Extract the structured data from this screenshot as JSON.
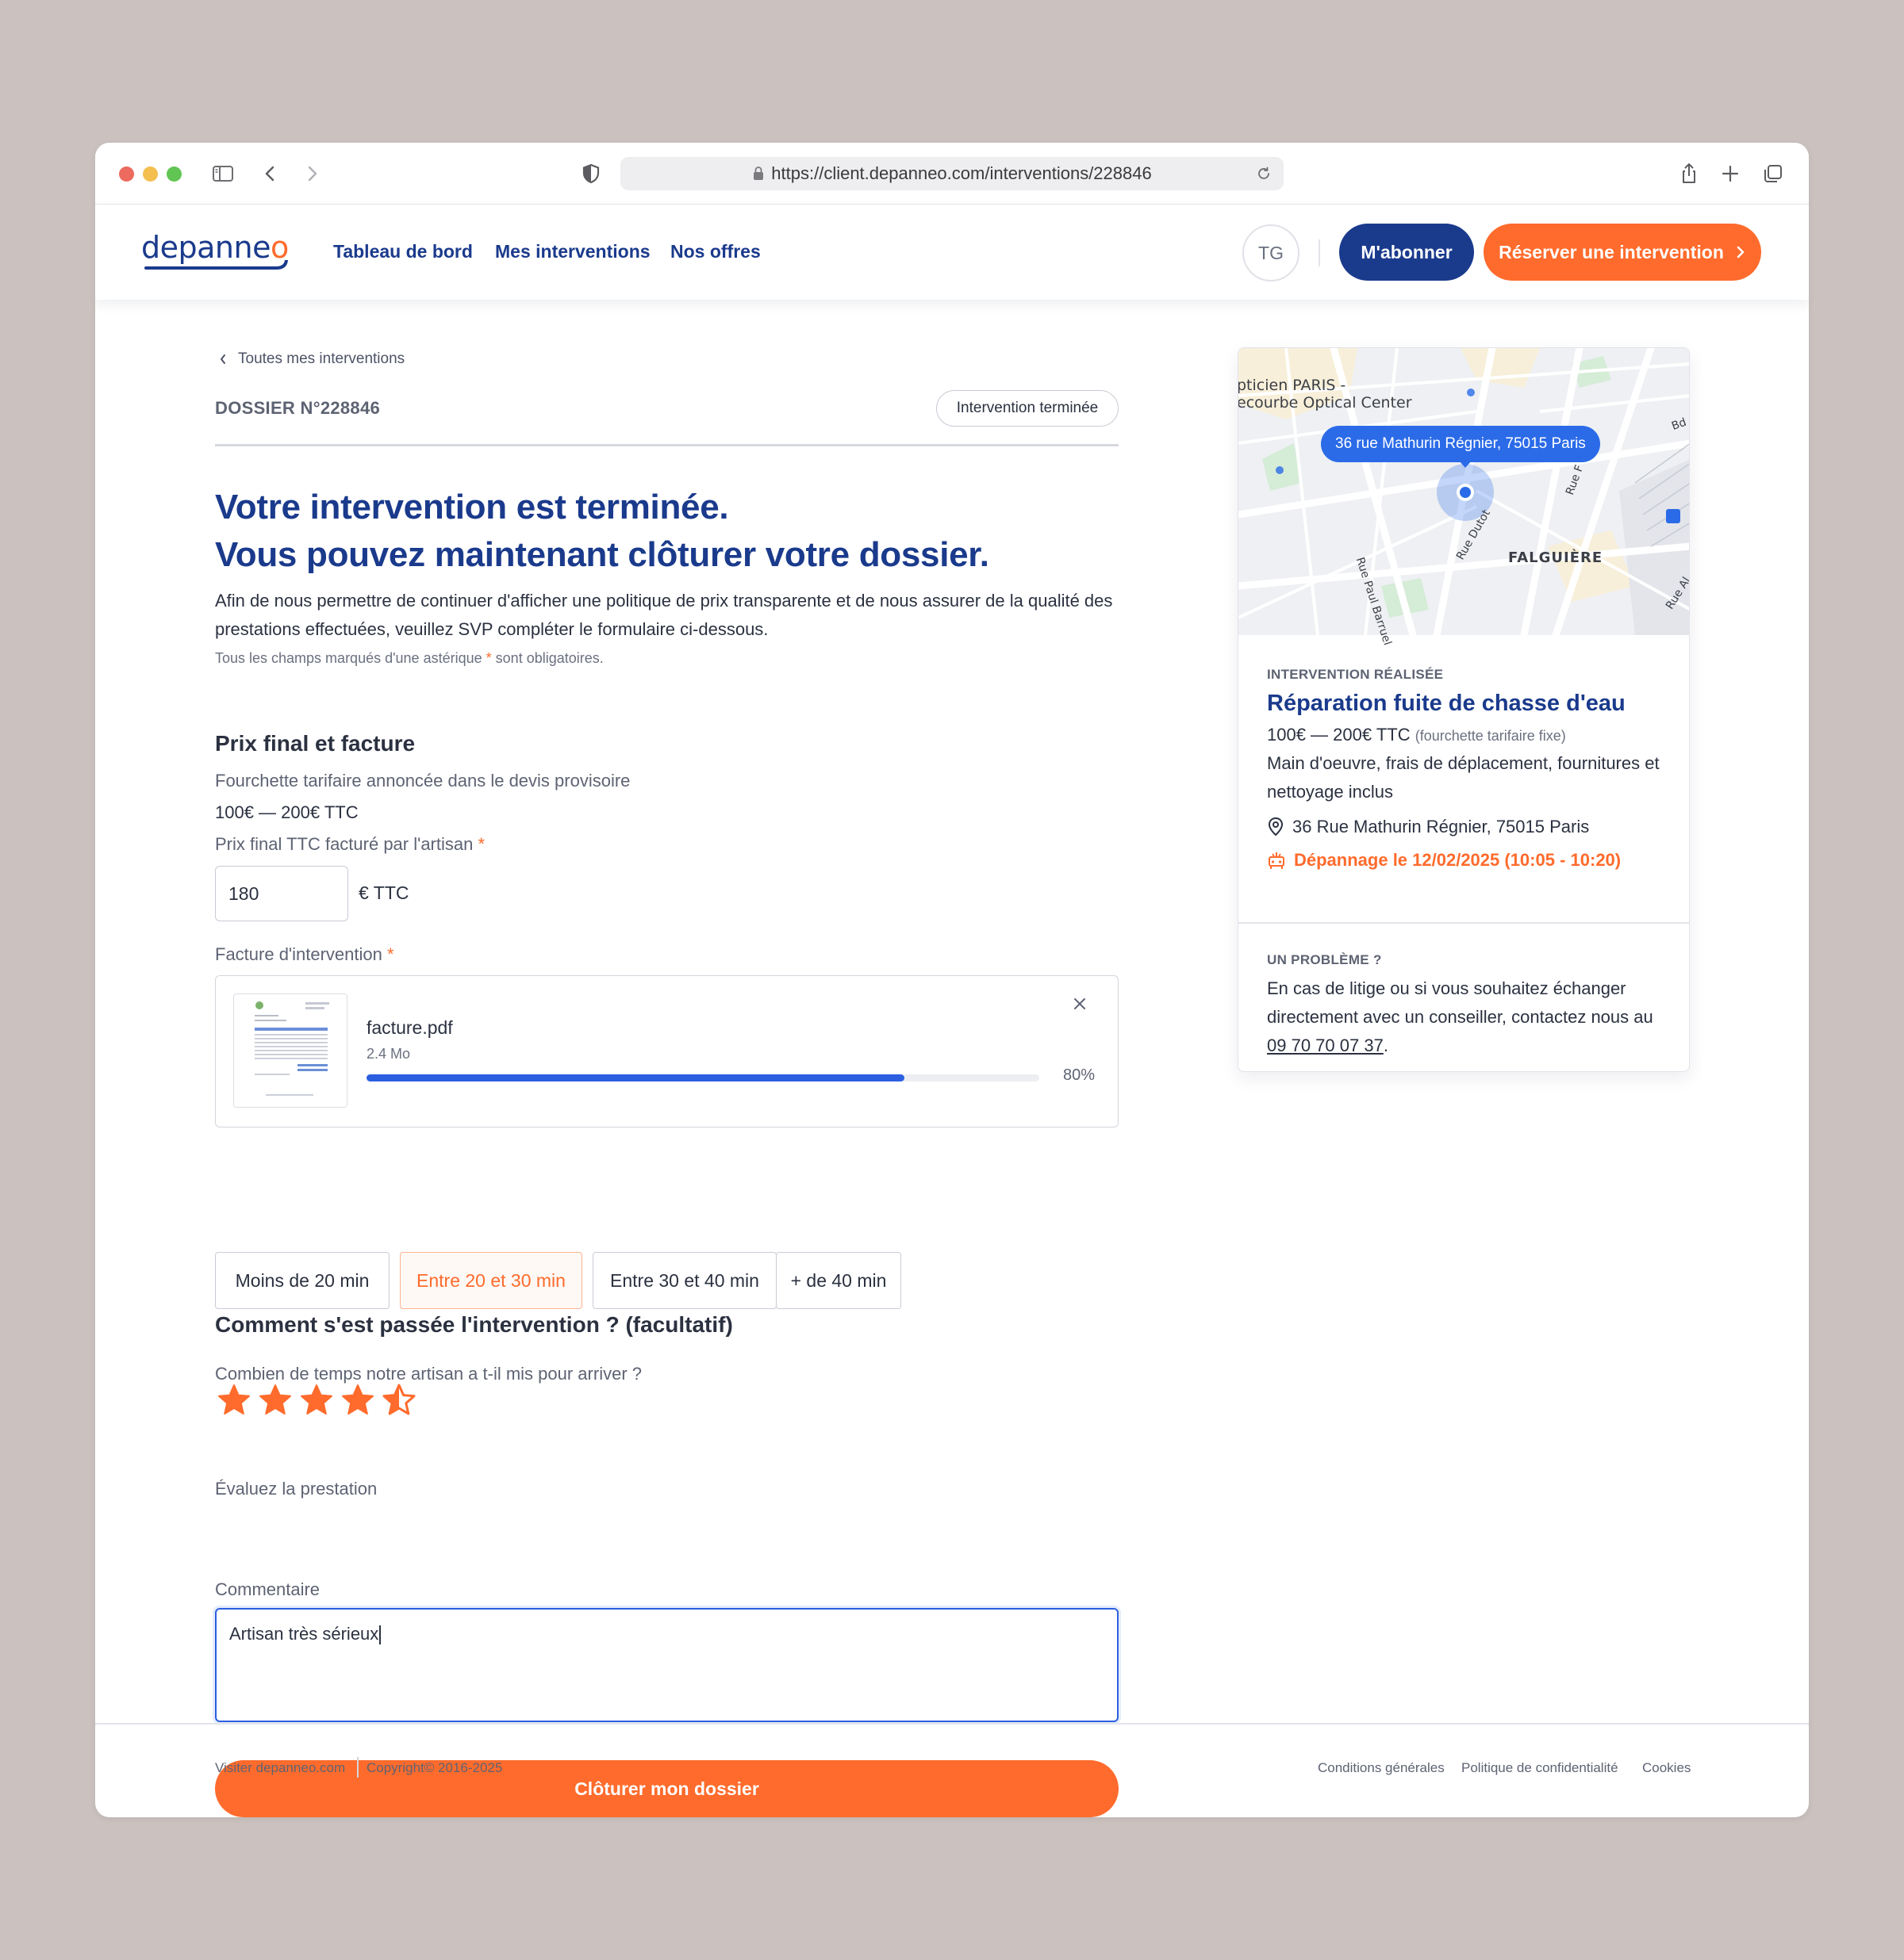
{
  "browser": {
    "url": "https://client.depanneo.com/interventions/228846"
  },
  "header": {
    "logo": "depanneo",
    "nav": [
      "Tableau de bord",
      "Mes interventions",
      "Nos offres"
    ],
    "avatar_initials": "TG",
    "subscribe_label": "M'abonner",
    "book_label": "Réserver une intervention"
  },
  "main": {
    "back_link": "Toutes mes interventions",
    "dossier": "DOSSIER N°228846",
    "status": "Intervention terminée",
    "title_line1": "Votre intervention est terminée.",
    "title_line2": "Vous pouvez maintenant clôturer votre dossier.",
    "intro": "Afin de nous permettre de continuer d'afficher une politique de prix transparente et de nous assurer de la qualité des prestations effectuées, veuillez SVP compléter le formulaire ci-dessous.",
    "required_note_before": "Tous les champs marqués d'une astérique",
    "required_note_after": "sont obligatoires.",
    "required_star": "*",
    "price_section": {
      "heading": "Prix final et facture",
      "range_label": "Fourchette tarifaire annoncée dans le devis provisoire",
      "range_value": "100€ — 200€ TTC",
      "final_price_label": "Prix final TTC facturé par l'artisan",
      "final_price_value": "180",
      "final_price_unit": "€ TTC",
      "invoice_label": "Facture d'intervention",
      "file_name": "facture.pdf",
      "file_size": "2.4 Mo",
      "upload_progress": 0.8,
      "upload_progress_text": "80%"
    },
    "feedback_section": {
      "heading": "Comment s'est passée l'intervention ? (facultatif)",
      "arrival_label": "Combien de temps notre artisan a t-il mis pour arriver ?",
      "arrival_options": [
        "Moins de 20 min",
        "Entre 20 et 30 min",
        "Entre 30 et 40 min",
        "+ de 40 min"
      ],
      "arrival_selected": "Entre 20 et 30 min",
      "rating_label": "Évaluez la prestation",
      "rating": 4.5,
      "rating_max": 5,
      "comment_label": "Commentaire",
      "comment_value": "Artisan très sérieux"
    },
    "submit_label": "Clôturer mon dossier"
  },
  "card": {
    "map": {
      "pill": "36 rue Mathurin Régnier, 75015 Paris",
      "poi_line1": "pticien PARIS -",
      "poi_line2": "ecourbe Optical Center",
      "district": "FALGUIÈRE",
      "streets": [
        "Rue Paul Barruel",
        "Rue Dutot",
        "Rue F",
        "Bd G",
        "Rue Al"
      ]
    },
    "eyebrow": "INTERVENTION RÉALISÉE",
    "title": "Réparation fuite de chasse d'eau",
    "price": "100€ — 200€ TTC",
    "price_note": "(fourchette tarifaire fixe)",
    "includes": "Main d'oeuvre, frais de déplacement, fournitures et nettoyage inclus",
    "address": "36 Rue Mathurin Régnier, 75015 Paris",
    "date": "Dépannage le 12/02/2025 (10:05 - 10:20)",
    "problem_eyebrow": "UN PROBLÈME ?",
    "problem_text": "En cas de litige ou si vous souhaitez échanger directement avec un conseiller, contactez nous au",
    "phone": "09 70 70 07 37",
    "problem_end": "."
  },
  "footer": {
    "visit": "Visiter depanneo.com",
    "copyright": "Copyright© 2016-2025",
    "links": [
      "Conditions générales",
      "Politique de confidentialité",
      "Cookies"
    ]
  },
  "colors": {
    "brand_blue": "#1a3a8c",
    "brand_orange": "#ff6b2c",
    "progress_blue": "#2b5fe0",
    "background": "#cbc2bf"
  }
}
